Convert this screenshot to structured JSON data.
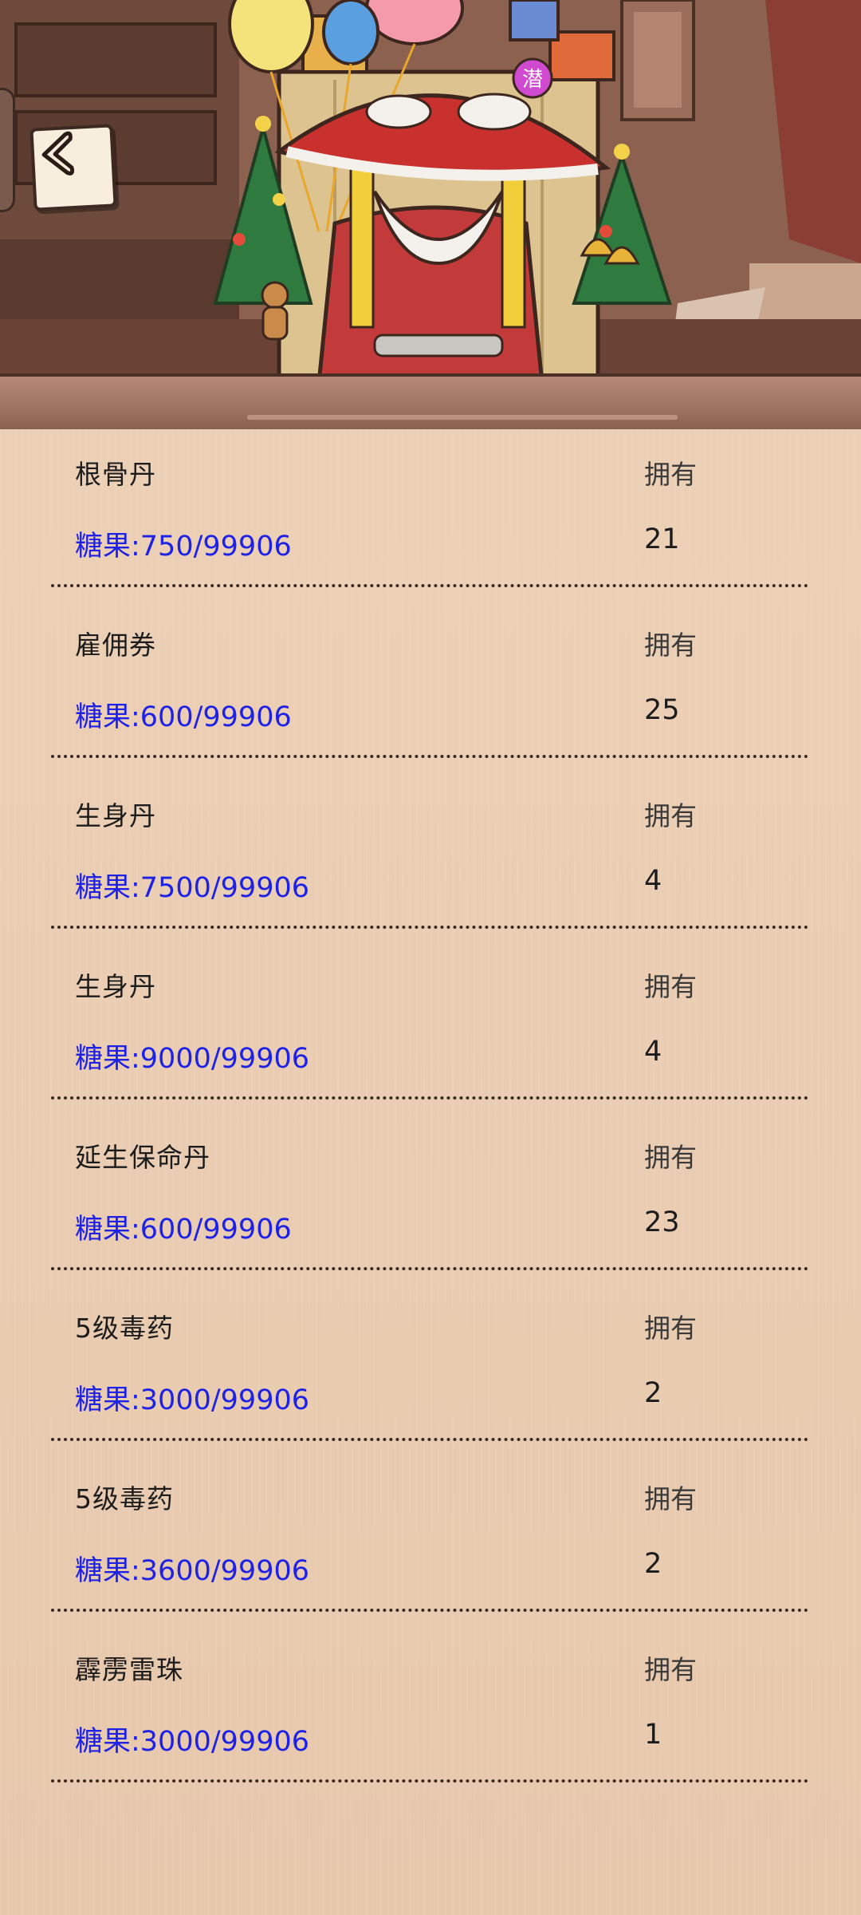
{
  "header": {
    "back_icon": "chevron-left-icon",
    "balloon_text": "潜"
  },
  "items": [
    {
      "name": "根骨丹",
      "own_label": "拥有",
      "price": "糖果:750/99906",
      "count": "21"
    },
    {
      "name": "雇佣券",
      "own_label": "拥有",
      "price": "糖果:600/99906",
      "count": "25"
    },
    {
      "name": "生身丹",
      "own_label": "拥有",
      "price": "糖果:7500/99906",
      "count": "4"
    },
    {
      "name": "生身丹",
      "own_label": "拥有",
      "price": "糖果:9000/99906",
      "count": "4"
    },
    {
      "name": "延生保命丹",
      "own_label": "拥有",
      "price": "糖果:600/99906",
      "count": "23"
    },
    {
      "name": "5级毒药",
      "own_label": "拥有",
      "price": "糖果:3000/99906",
      "count": "2"
    },
    {
      "name": "5级毒药",
      "own_label": "拥有",
      "price": "糖果:3600/99906",
      "count": "2"
    },
    {
      "name": "霹雳雷珠",
      "own_label": "拥有",
      "price": "糖果:3000/99906",
      "count": "1"
    }
  ],
  "colors": {
    "price_text": "#1d22e6",
    "background": "#e9c8ad"
  }
}
